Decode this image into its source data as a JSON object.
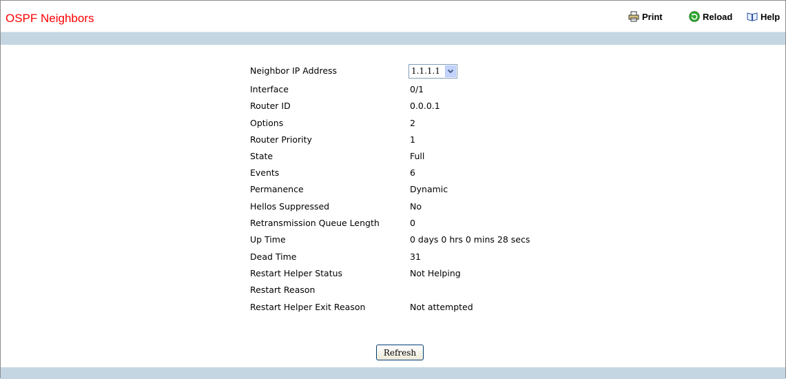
{
  "header": {
    "title": "OSPF Neighbors",
    "toolbar": {
      "print": "Print",
      "reload": "Reload",
      "help": "Help"
    }
  },
  "details": {
    "neighbor_ip": {
      "label": "Neighbor IP Address",
      "selected": "1.1.1.1"
    },
    "rows": [
      {
        "label": "Interface",
        "value": "0/1"
      },
      {
        "label": "Router ID",
        "value": "0.0.0.1"
      },
      {
        "label": "Options",
        "value": "2"
      },
      {
        "label": "Router Priority",
        "value": "1"
      },
      {
        "label": "State",
        "value": "Full"
      },
      {
        "label": "Events",
        "value": "6"
      },
      {
        "label": "Permanence",
        "value": "Dynamic"
      },
      {
        "label": "Hellos Suppressed",
        "value": "No"
      },
      {
        "label": "Retransmission Queue Length",
        "value": "0"
      },
      {
        "label": "Up Time",
        "value": "0 days 0 hrs 0 mins 28 secs"
      },
      {
        "label": "Dead Time",
        "value": "31"
      },
      {
        "label": "Restart Helper Status",
        "value": "Not Helping"
      },
      {
        "label": "Restart Reason",
        "value": ""
      },
      {
        "label": "Restart Helper Exit Reason",
        "value": "Not attempted"
      }
    ]
  },
  "actions": {
    "refresh_label": "Refresh"
  },
  "icons": {
    "print": "printer-icon",
    "reload": "reload-icon",
    "help": "book-icon"
  }
}
